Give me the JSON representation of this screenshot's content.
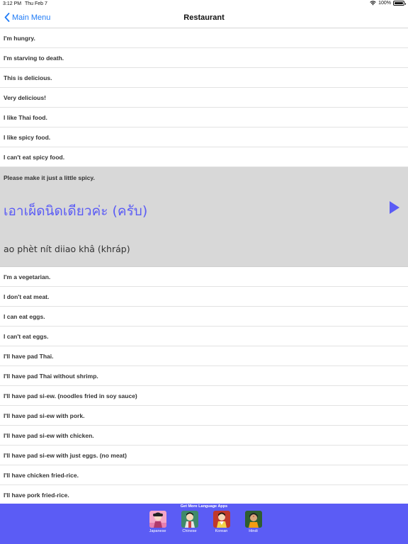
{
  "status": {
    "time": "3:12 PM",
    "date": "Thu Feb 7",
    "battery": "100%"
  },
  "nav": {
    "back_label": "Main Menu",
    "title": "Restaurant"
  },
  "phrases_before": [
    "I'm hungry.",
    "I'm starving to death.",
    "This is delicious.",
    "Very delicious!",
    "I like Thai food.",
    "I like spicy food.",
    "I can't eat spicy food."
  ],
  "expanded": {
    "english": "Please make it just a little spicy.",
    "thai": "เอาเผ็ดนิดเดียวค่ะ (ครับ)",
    "romanization": "ao phèt nít diiao khâ (khráp)"
  },
  "phrases_after": [
    "I'm a vegetarian.",
    "I don't eat meat.",
    "I can eat eggs.",
    "I can't eat eggs.",
    "I'll have pad Thai.",
    "I'll have pad Thai without shrimp.",
    "I'll have pad si-ew. (noodles fried in soy sauce)",
    "I'll have pad si-ew with pork.",
    "I'll have pad si-ew with chicken.",
    "I'll have pad si-ew with just eggs. (no meat)",
    "I'll have chicken fried-rice.",
    "I'll have pork fried-rice."
  ],
  "footer": {
    "title": "Get More Language Apps",
    "apps": [
      "Japanese",
      "Chinese",
      "Korean",
      "Hindi"
    ]
  },
  "colors": {
    "accent": "#5b5cf5",
    "link": "#1f7bf6",
    "expanded_bg": "#d8d8d8"
  }
}
